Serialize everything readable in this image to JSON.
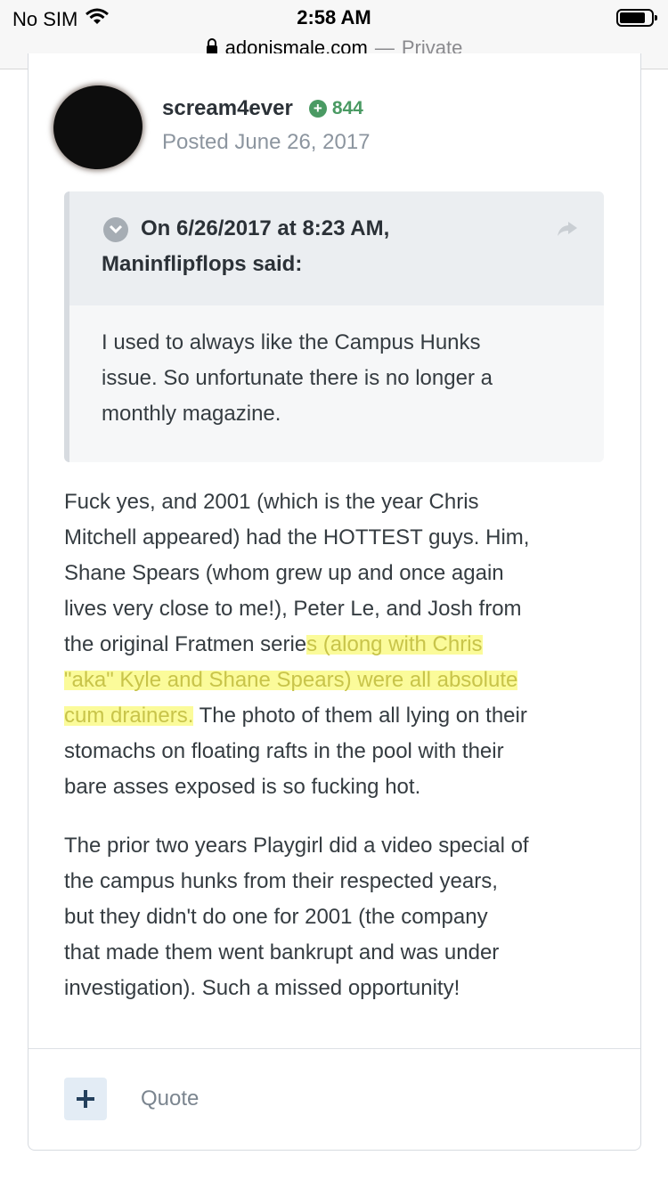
{
  "status_bar": {
    "carrier": "No SIM",
    "time": "2:58 AM"
  },
  "browser": {
    "domain": "adonismale.com",
    "separator": "—",
    "mode": "Private"
  },
  "post": {
    "author": "scream4ever",
    "reputation": "844",
    "posted": "Posted June 26, 2017",
    "quote": {
      "citation_line1": "On 6/26/2017 at 8:23 AM,",
      "citation_line2": "Maninflipflops said:",
      "lines": [
        "I used to always like the Campus Hunks",
        "issue. So unfortunate there is no longer a",
        "monthly magazine."
      ]
    },
    "paragraph1": {
      "line1": "Fuck yes, and 2001 (which is the year Chris",
      "line2": "Mitchell appeared) had the HOTTEST guys. Him,",
      "line3": "Shane Spears (whom grew up and once again",
      "line4": "lives very close to me!), Peter Le, and Josh from",
      "line5_plain": "the original Fratmen serie",
      "line5_highlight": "s (along with Chris",
      "line6_highlight": "\"aka\" Kyle and Shane Spears) were all absolute",
      "line7_highlight": "cum drainers.",
      "line7_plain": " The photo of them all lying on their",
      "line8": "stomachs on floating rafts in the pool with their",
      "line9": "bare asses exposed is so fucking hot."
    },
    "paragraph2": [
      "The prior two years Playgirl did a video special of",
      "the campus hunks from their respected years,",
      "but they didn't do one for 2001 (the company",
      "that made them went bankrupt and was under",
      "investigation). Such a missed opportunity!"
    ]
  },
  "footer": {
    "quote_label": "Quote"
  },
  "colors": {
    "reputation_green": "#4a9a63",
    "highlight_yellow": "#fbfb9a",
    "highlight_text": "#c8c44a"
  },
  "icons": [
    "wifi-icon",
    "battery-icon",
    "lock-icon",
    "reputation-plus-icon",
    "chevron-down-icon",
    "share-icon",
    "plus-icon"
  ]
}
